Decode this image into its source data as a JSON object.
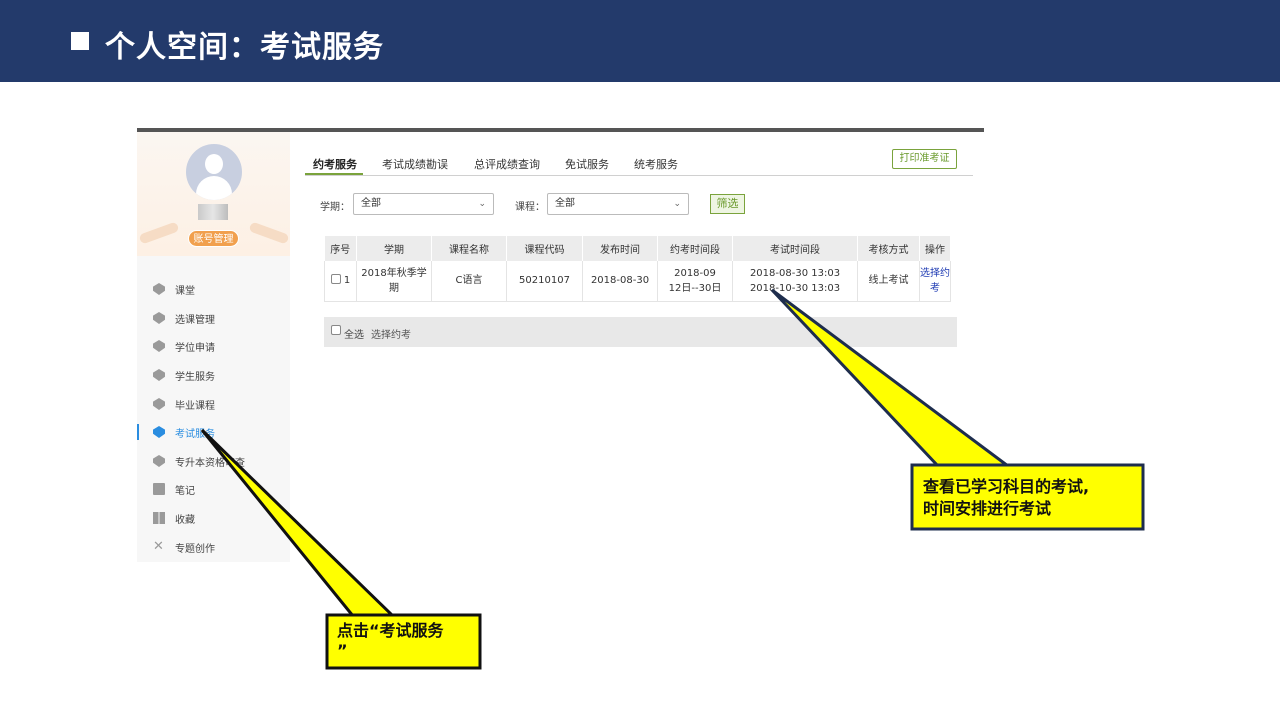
{
  "slide": {
    "title": "个人空间：考试服务"
  },
  "sidebar": {
    "account_button": "账号管理",
    "items": [
      {
        "label": "课堂",
        "icon": "graduation-cap-icon"
      },
      {
        "label": "选课管理",
        "icon": "graduation-cap-icon"
      },
      {
        "label": "学位申请",
        "icon": "graduation-cap-icon"
      },
      {
        "label": "学生服务",
        "icon": "graduation-cap-icon"
      },
      {
        "label": "毕业课程",
        "icon": "graduation-cap-icon"
      },
      {
        "label": "考试服务",
        "icon": "graduation-cap-icon",
        "active": true
      },
      {
        "label": "专升本资格审查",
        "icon": "graduation-cap-icon"
      },
      {
        "label": "笔记",
        "icon": "note-icon"
      },
      {
        "label": "收藏",
        "icon": "book-icon"
      },
      {
        "label": "专题创作",
        "icon": "tools-icon"
      }
    ]
  },
  "tabs": [
    {
      "label": "约考服务",
      "active": true
    },
    {
      "label": "考试成绩勘误"
    },
    {
      "label": "总评成绩查询"
    },
    {
      "label": "免试服务"
    },
    {
      "label": "统考服务"
    }
  ],
  "print_button": "打印准考证",
  "filters": {
    "term_label": "学期：",
    "term_value": "全部",
    "course_label": "课程：",
    "course_value": "全部",
    "filter_button": "筛选"
  },
  "table": {
    "headers": [
      "序号",
      "学期",
      "课程名称",
      "课程代码",
      "发布时间",
      "约考时间段",
      "考试时间段",
      "考核方式",
      "操作"
    ],
    "row": {
      "index": "1",
      "term": "2018年秋季学期",
      "course": "C语言",
      "code": "50210107",
      "publish": "2018-08-30",
      "book_line1": "2018-09",
      "book_line2": "12日--30日",
      "exam_line1": "2018-08-30 13:03",
      "exam_line2": "2018-10-30 13:03",
      "method": "线上考试",
      "action_line1": "选择约",
      "action_line2": "考"
    }
  },
  "bottom": {
    "select_all": "全选",
    "select_exam": "选择约考"
  },
  "callouts": {
    "right_line1": "查看已学习科目的考试,",
    "right_line2": "时间安排进行考试",
    "left_line1": "点击“考试服务",
    "left_line2": "”"
  },
  "colors": {
    "header_bg": "#233a6b",
    "callout_fill": "#ffff00",
    "accent_green": "#7aa33c",
    "accent_blue": "#2a8de0"
  }
}
